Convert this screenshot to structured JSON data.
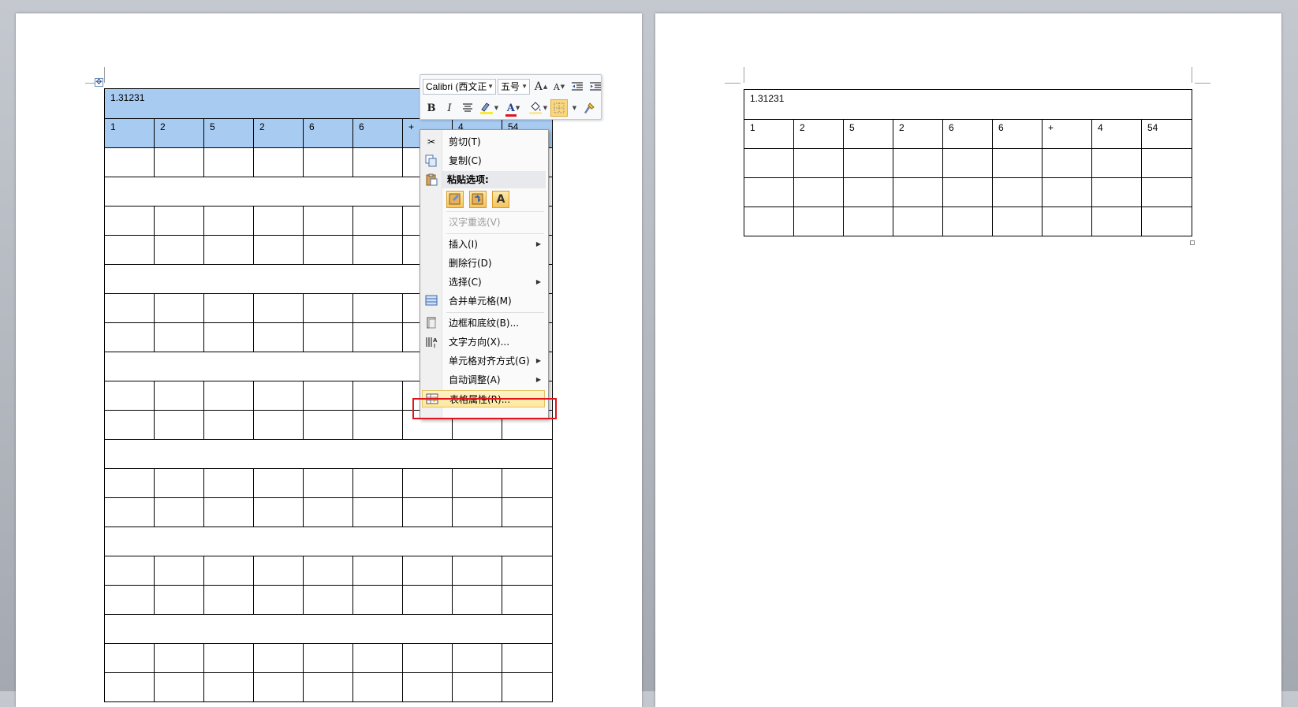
{
  "document": {
    "table_title": "1.31231",
    "header_row": [
      "1",
      "2",
      "5",
      "2",
      "6",
      "6",
      "+",
      "4",
      "54"
    ]
  },
  "mini_toolbar": {
    "font_name": "Calibri (西文正",
    "font_size": "五号",
    "grow_font_label": "A",
    "shrink_font_label": "A",
    "bold_label": "B",
    "italic_label": "I",
    "font_color_label": "A",
    "font_color": "#e0141c"
  },
  "context_menu": {
    "items": [
      {
        "label": "剪切(T)",
        "icon": "scissors-icon"
      },
      {
        "label": "复制(C)",
        "icon": "copy-icon"
      },
      {
        "label": "粘贴选项:",
        "icon": "paste-icon"
      },
      {
        "label": "汉字重选(V)",
        "icon": ""
      },
      {
        "label": "插入(I)",
        "icon": ""
      },
      {
        "label": "删除行(D)",
        "icon": ""
      },
      {
        "label": "选择(C)",
        "icon": ""
      },
      {
        "label": "合并单元格(M)",
        "icon": "merge-cells-icon"
      },
      {
        "label": "边框和底纹(B)...",
        "icon": "borders-icon"
      },
      {
        "label": "文字方向(X)...",
        "icon": "text-direction-icon"
      },
      {
        "label": "单元格对齐方式(G)",
        "icon": ""
      },
      {
        "label": "自动调整(A)",
        "icon": ""
      },
      {
        "label": "表格属性(R)...",
        "icon": "table-properties-icon"
      }
    ],
    "paste_option_labels": [
      "",
      "",
      "A"
    ]
  },
  "colors": {
    "selection": "#a8cbf1",
    "highlight_box": "#e0141c",
    "menu_hover": "#fde89c"
  }
}
